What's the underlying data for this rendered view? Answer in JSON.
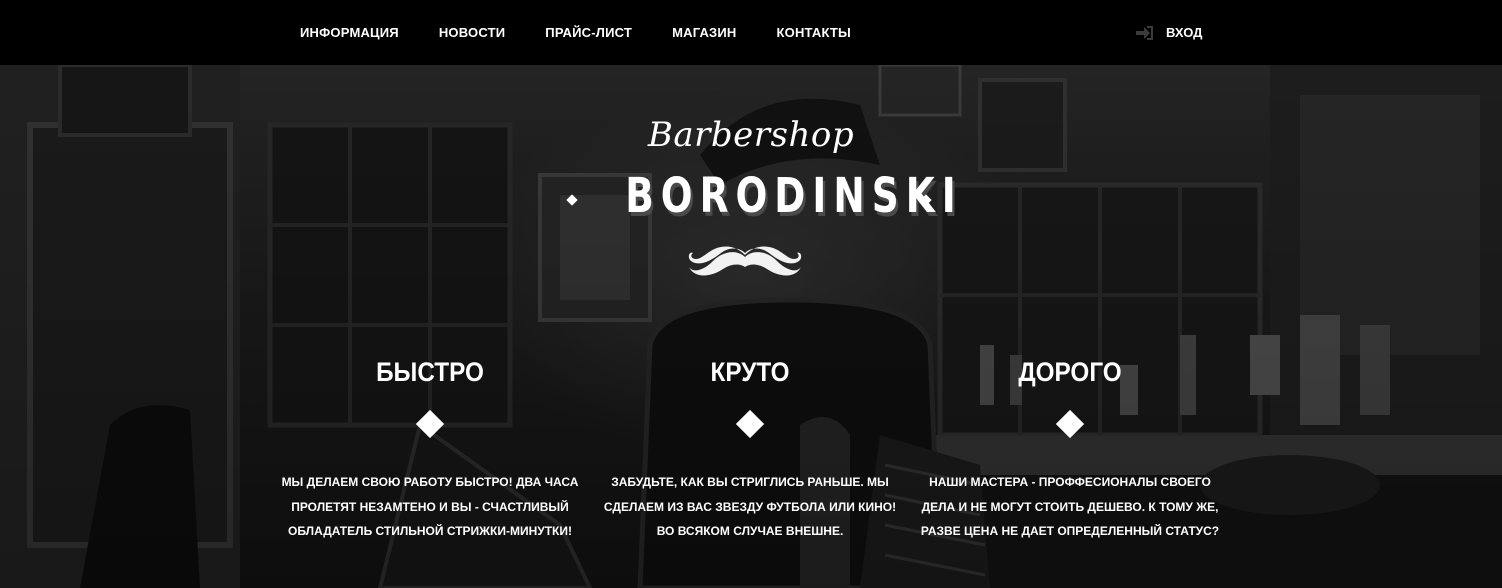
{
  "nav": {
    "items": [
      {
        "label": "ИНФОРМАЦИЯ"
      },
      {
        "label": "НОВОСТИ"
      },
      {
        "label": "ПРАЙС-ЛИСТ"
      },
      {
        "label": "МАГАЗИН"
      },
      {
        "label": "КОНТАКТЫ"
      }
    ],
    "login_label": "ВХОД",
    "login_icon": "sign-in-icon"
  },
  "logo": {
    "script": "Barbershop",
    "main": "BORODINSKI",
    "icon": "mustache-icon"
  },
  "features": [
    {
      "title": "БЫСТРО",
      "text": "Мы делаем свою работу быстро! Два часа пролетят незамтено и вы - счастливый обладатель стильной стрижки-минутки!"
    },
    {
      "title": "КРУТО",
      "text": "Забудьте, как вы стриглись раньше. Мы сделаем из вас звезду футбола или кино! Во всяком случае внешне."
    },
    {
      "title": "ДОРОГО",
      "text": "Наши мастера - проффесионалы своего дела и не могут стоить дешево. К тому же, разве цена не дает определенный статус?"
    }
  ],
  "colors": {
    "nav_bg": "#000000",
    "text": "#ffffff",
    "hero_bg": "#1e1e1e"
  }
}
